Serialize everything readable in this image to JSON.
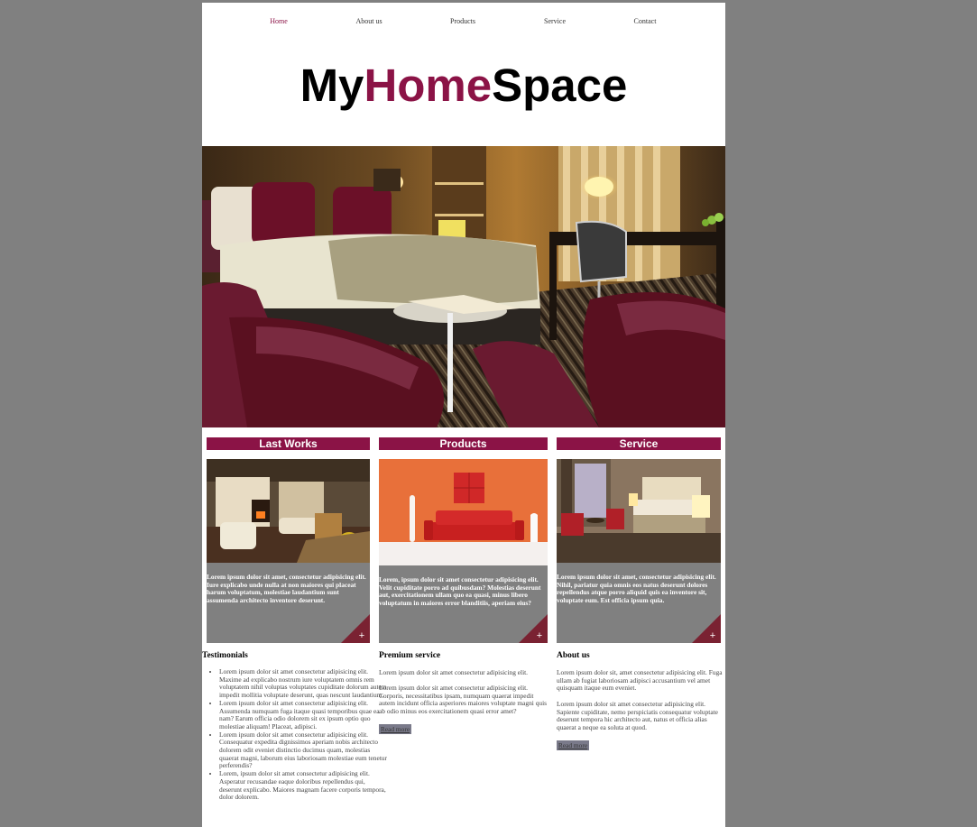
{
  "nav": {
    "items": [
      "Home",
      "About us",
      "Products",
      "Service",
      "Contact"
    ],
    "active_color": "#8b1346"
  },
  "logo": {
    "part1": "My",
    "part2": "Home",
    "part3": "Space",
    "accent": "#8b1346"
  },
  "hero": {
    "image": "hotel-bedroom-photo"
  },
  "columns": [
    {
      "heading": "Last Works",
      "image": "living-room-photo",
      "text": "Lorem ipsum dolor sit amet, consectetur adipisicing elit. Iure explicabo unde nulla at non maiores qui placeat harum voluptatum, molestiae laudantium sunt assumenda architecto inventore deserunt.",
      "plus": "+"
    },
    {
      "heading": "Products",
      "image": "red-sofa-photo",
      "text": "Lorem, ipsum dolor sit amet consectetur adipisicing elit. Velit cupiditate porro ad quibusdam? Molestias deserunt aut, exercitationem ullam quo ea quasi, minus libero voluptatum in maiores error blanditiis, aperiam eius?",
      "plus": "+"
    },
    {
      "heading": "Service",
      "image": "hotel-room-photo",
      "text": "Lorem ipsum dolor sit amet, consectetur adipisicing elit. Nihil, pariatur quia omnis eos natus deserunt dolores repellendus atque porro aliquid quis ea inventore sit, voluptate eum. Est officia ipsum quia.",
      "plus": "+"
    }
  ],
  "testimonials": {
    "heading": "Testimonials",
    "items": [
      "Lorem ipsum dolor sit amet consectetur adipisicing elit. Maxime ad explicabo nostrum iure voluptatem omnis rem voluptatem nihil voluptas voluptates cupiditate dolorum autem impedit mollitia voluptate deserunt, quas nescunt laudantium.",
      "Lorem ipsum dolor sit amet consectetur adipisicing elit. Assumenda numquam fuga itaque quasi temporibus quae ea nam? Earum officia odio dolorem sit ex ipsum optio quo molestiae aliquam! Placeat, adipisci.",
      "Lorem ipsum dolor sit amet consectetur adipisicing elit. Consequatur expedita dignissimos aperiam nobis architecto dolorem odit eveniet distinctio ducimus quam, molestias quaerat magni, laborum eius laboriosam molestiae eum tenetur perferendis?",
      "Lorem, ipsum dolor sit amet consectetur adipisicing elit. Asperatur recusandae eaque doloribus repellendus qui, deserunt explicabo. Maiores magnam facere corporis tempora, dolor dolorem."
    ]
  },
  "premium": {
    "heading": "Premium service",
    "p1": "Lorem ipsum dolor sit amet consectetur adipisicing elit.",
    "p2": "Lorem ipsum dolor sit amet consectetur adipisicing elit. Corporis, necessitatibus ipsam, numquam quaerat impedit autem incidunt officia asperiores maiores voluptate magni quis ab odio minus eos exercitationem quasi error amet?",
    "read_more": "Read more"
  },
  "about": {
    "heading": "About us",
    "p1": "Lorem ipsum dolor sit, amet consectetur adipisicing elit. Fuga ullam ab fugiat laboriosam adipisci accusantium vel amet quisquam itaque eum eveniet.",
    "p2": "Lorem ipsum dolor sit amet consectetur adipisicing elit. Sapiente cupiditate, nemo perspiciatis consequatur voluptate deserunt tempora hic architecto aut, natus et officia alias quaerat a neque ea soluta at quod.",
    "read_more": "Read more"
  }
}
